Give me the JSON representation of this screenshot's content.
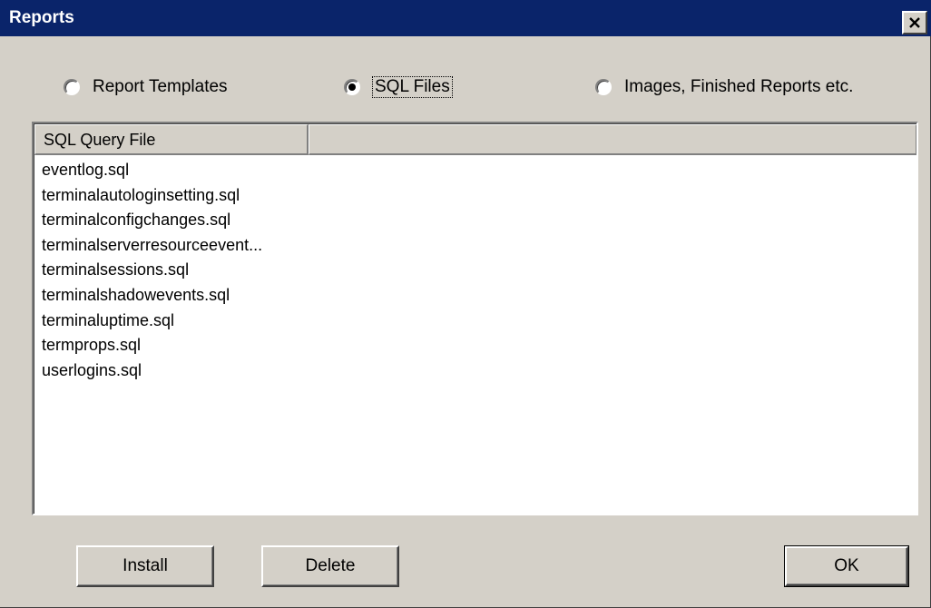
{
  "window": {
    "title": "Reports",
    "close_icon": "close-icon"
  },
  "options": {
    "items": [
      {
        "label": "Report Templates",
        "selected": false
      },
      {
        "label": "SQL Files",
        "selected": true
      },
      {
        "label": "Images, Finished Reports etc.",
        "selected": false
      }
    ]
  },
  "list": {
    "columns": [
      "SQL Query File",
      ""
    ],
    "rows": [
      "eventlog.sql",
      "terminalautologinsetting.sql",
      "terminalconfigchanges.sql",
      "terminalserverresourceevent...",
      "terminalsessions.sql",
      "terminalshadowevents.sql",
      "terminaluptime.sql",
      "termprops.sql",
      "userlogins.sql"
    ]
  },
  "buttons": {
    "install": "Install",
    "delete": "Delete",
    "ok": "OK"
  }
}
